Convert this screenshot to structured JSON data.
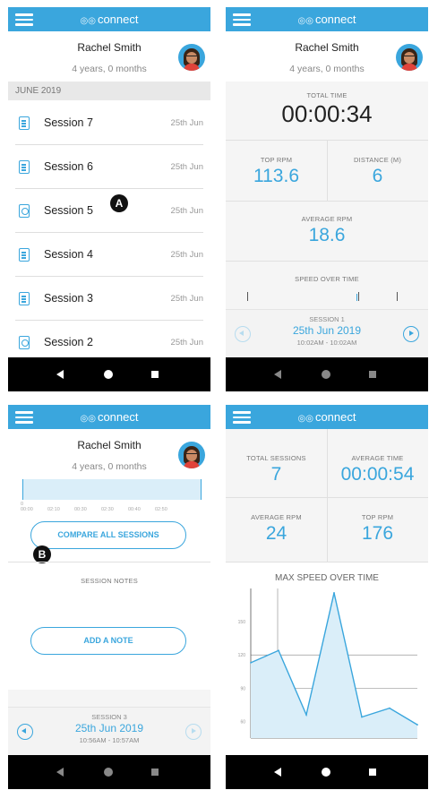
{
  "app": {
    "brand": "connect",
    "user_name": "Rachel Smith",
    "user_age": "4 years, 0 months",
    "accent_color": "#3aa6dd",
    "icons": [
      "menu-icon",
      "avatar",
      "document-icon",
      "back-icon",
      "home-icon",
      "recents-icon",
      "circle-left-arrow-icon",
      "circle-right-arrow-icon"
    ]
  },
  "screen1": {
    "month": "JUNE 2019",
    "sessions": [
      {
        "name": "Session 7",
        "date": "25th Jun"
      },
      {
        "name": "Session 6",
        "date": "25th Jun"
      },
      {
        "name": "Session 5",
        "date": "25th Jun"
      },
      {
        "name": "Session 4",
        "date": "25th Jun"
      },
      {
        "name": "Session 3",
        "date": "25th Jun"
      },
      {
        "name": "Session 2",
        "date": "25th Jun"
      }
    ],
    "marker": "A"
  },
  "screen2": {
    "total_time_label": "TOTAL TIME",
    "total_time": "00:00:34",
    "top_rpm_label": "TOP RPM",
    "top_rpm": "113.6",
    "distance_label": "DISTANCE (M)",
    "distance": "6",
    "avg_rpm_label": "AVERAGE RPM",
    "avg_rpm": "18.6",
    "speed_label": "SPEED OVER TIME",
    "footer": {
      "session": "SESSION 1",
      "date": "25th Jun 2019",
      "time": "10:02AM - 10:02AM"
    }
  },
  "screen3": {
    "mini_ticks": [
      "0",
      "00:00",
      "02:10",
      "00:30",
      "02:30",
      "00:40",
      "02:50"
    ],
    "compare_label": "COMPARE ALL SESSIONS",
    "marker": "B",
    "notes_label": "SESSION NOTES",
    "add_note_label": "ADD A NOTE",
    "footer": {
      "session": "SESSION 3",
      "date": "25th Jun 2019",
      "time": "10:56AM - 10:57AM"
    }
  },
  "screen4": {
    "total_sessions_label": "TOTAL SESSIONS",
    "total_sessions": "7",
    "avg_time_label": "AVERAGE TIME",
    "avg_time": "00:00:54",
    "avg_rpm_label": "AVERAGE RPM",
    "avg_rpm": "24",
    "top_rpm_label": "TOP RPM",
    "top_rpm": "176",
    "chart_title": "MAX SPEED OVER TIME",
    "y_ticks": [
      "150",
      "120",
      "90",
      "60"
    ]
  },
  "chart_data": {
    "type": "area",
    "title": "MAX SPEED OVER TIME",
    "x": [
      1,
      2,
      3,
      4,
      5,
      6,
      7
    ],
    "series": [
      {
        "values": [
          113,
          124,
          66,
          176,
          64,
          72,
          57
        ]
      }
    ],
    "ylim": [
      45,
      180
    ],
    "yticks": [
      60,
      90,
      120,
      150
    ],
    "color": "#3aa6dd",
    "grid": false
  }
}
